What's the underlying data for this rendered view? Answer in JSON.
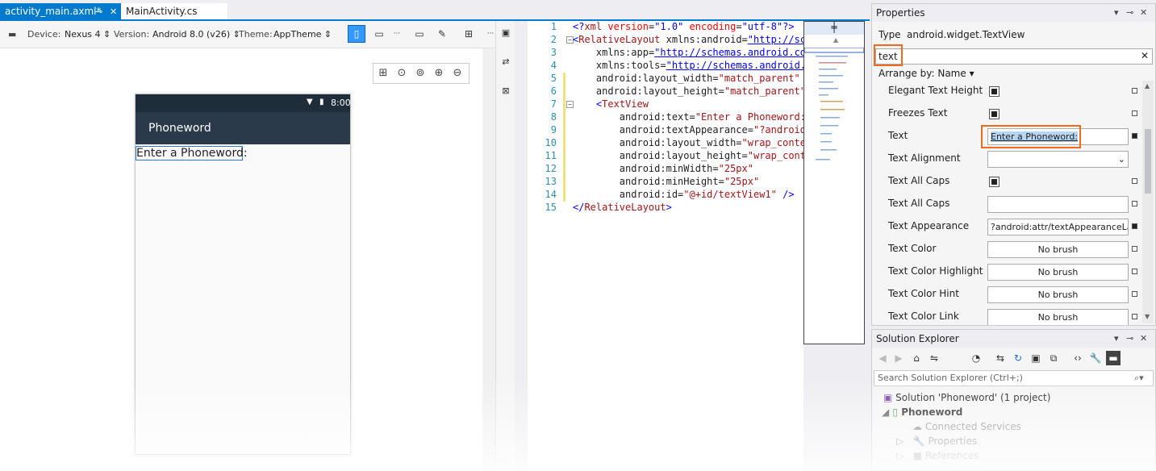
{
  "tabs": [
    {
      "label": "activity_main.axml*",
      "active": true
    },
    {
      "label": "MainActivity.cs",
      "active": false
    }
  ],
  "designer_toolbar": {
    "device_label": "Device:",
    "device_value": "Nexus 4",
    "version_label": "Version:",
    "version_value": "Android 8.0 (v26)",
    "theme_label": "Theme:",
    "theme_value": "AppTheme",
    "more": "···"
  },
  "phone": {
    "time": "8:00",
    "app_title": "Phoneword",
    "textview_text": "Enter a Phoneword:"
  },
  "editor": {
    "line_numbers": [
      "1",
      "2",
      "3",
      "4",
      "5",
      "6",
      "7",
      "8",
      "9",
      "10",
      "11",
      "12",
      "13",
      "14",
      "15"
    ]
  },
  "properties": {
    "title": "Properties",
    "type_label": "Type",
    "type_value": "android.widget.TextView",
    "search_value": "text",
    "arrange_label": "Arrange by: Name",
    "rows": [
      {
        "label": "Elegant Text Height",
        "kind": "check",
        "checked": true
      },
      {
        "label": "Freezes Text",
        "kind": "check",
        "checked": true
      },
      {
        "label": "Text",
        "kind": "text",
        "value": "Enter a Phoneword:"
      },
      {
        "label": "Text Alignment",
        "kind": "select",
        "value": ""
      },
      {
        "label": "Text All Caps",
        "kind": "check",
        "checked": true
      },
      {
        "label": "Text All Caps",
        "kind": "text",
        "value": ""
      },
      {
        "label": "Text Appearance",
        "kind": "text",
        "value": "?android:attr/textAppearanceLar"
      },
      {
        "label": "Text Color",
        "kind": "brush",
        "value": "No brush"
      },
      {
        "label": "Text Color Highlight",
        "kind": "brush",
        "value": "No brush"
      },
      {
        "label": "Text Color Hint",
        "kind": "brush",
        "value": "No brush"
      },
      {
        "label": "Text Color Link",
        "kind": "brush",
        "value": "No brush"
      }
    ]
  },
  "solution_explorer": {
    "title": "Solution Explorer",
    "search_placeholder": "Search Solution Explorer (Ctrl+;)",
    "solution": "Solution 'Phoneword' (1 project)",
    "project": "Phoneword",
    "items": [
      "Connected Services",
      "Properties",
      "References"
    ]
  },
  "colors": {
    "accent": "#007acc",
    "highlight": "#ee6a1c",
    "phone_appbar": "#2b3a4a",
    "selection": "#2a7ad8"
  }
}
